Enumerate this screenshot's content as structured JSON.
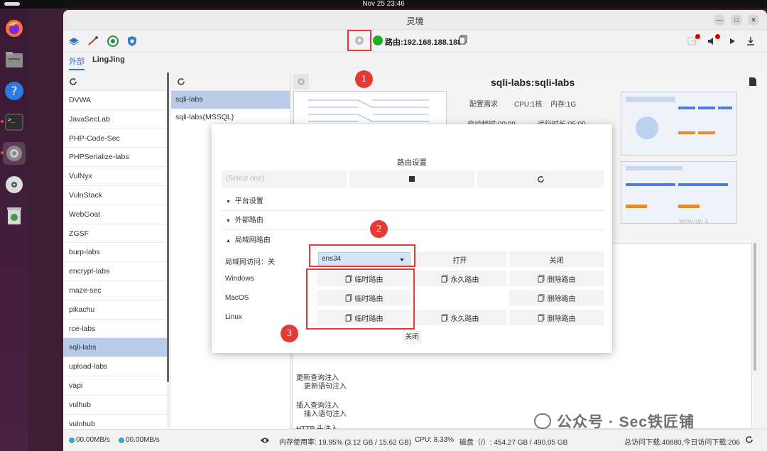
{
  "system": {
    "clock": "Nov 25  23:46"
  },
  "window": {
    "title": "灵境"
  },
  "toolbar": {
    "route_label": "路由:192.168.188.188"
  },
  "tabs": [
    {
      "label": "外部",
      "active": true
    },
    {
      "label": "LingJing",
      "active": false
    }
  ],
  "left_list": {
    "items": [
      "DVWA",
      "JavaSecLab",
      "PHP-Code-Sec",
      "PHPSerialize-labs",
      "VulNyx",
      "VulnStack",
      "WebGoat",
      "ZGSF",
      "burp-labs",
      "encrypt-labs",
      "maze-sec",
      "pikachu",
      "rce-labs",
      "sqli-labs",
      "upload-labs",
      "vapi",
      "vulhub",
      "vulnhub"
    ],
    "selected": "sqli-labs"
  },
  "mid_list": {
    "items": [
      "sqli-labs",
      "sqli-labs(MSSQL)"
    ],
    "selected": "sqli-labs"
  },
  "detail": {
    "title": "sqli-labs:sqli-labs",
    "config_label": "配置需求",
    "cpu": "CPU:1核",
    "mem": "内存:1G",
    "startup": "启动耗时:00:09",
    "runtime": "运行时长:05:00",
    "writeup_label": "write-up 1",
    "text_lines": [
      "更新查询注入",
      "更新语句注入",
      "插入查询注入",
      "插入语句注入",
      "HTTP 头注入"
    ]
  },
  "statusbar": {
    "upload": "00.00MB/s",
    "download": "00.00MB/s",
    "memory": "内存使用率: 19.95% (3.12 GB / 15.62 GB)",
    "cpu": "CPU: 8.33%",
    "disk": "磁盘（/）: 454.27 GB / 490.05 GB",
    "traffic": "总访问下载:40880,今日访问下载:206"
  },
  "watermark": "公众号 · Sec铁匠铺",
  "modal": {
    "title": "路由设置",
    "select_placeholder": "(Select one)",
    "sections": [
      "平台设置",
      "外部路由",
      "局域网路由"
    ],
    "lan_access_label": "局域网访问：关",
    "interface": "ens34",
    "open_label": "打开",
    "close_label": "关闭",
    "os_rows": [
      {
        "os": "Windows",
        "temp": "临时路由",
        "perm": "永久路由",
        "del": "删除路由"
      },
      {
        "os": "MacOS",
        "temp": "临时路由",
        "perm": "",
        "del": "删除路由"
      },
      {
        "os": "Linux",
        "temp": "临时路由",
        "perm": "永久路由",
        "del": "删除路由"
      }
    ],
    "footer_close": "关闭"
  },
  "annotations": [
    "1",
    "2",
    "3"
  ],
  "colors": {
    "accent": "#2c6fd6",
    "annotation_red": "#e53935",
    "status_green": "#1fae24",
    "selection": "#b9cbe8"
  }
}
